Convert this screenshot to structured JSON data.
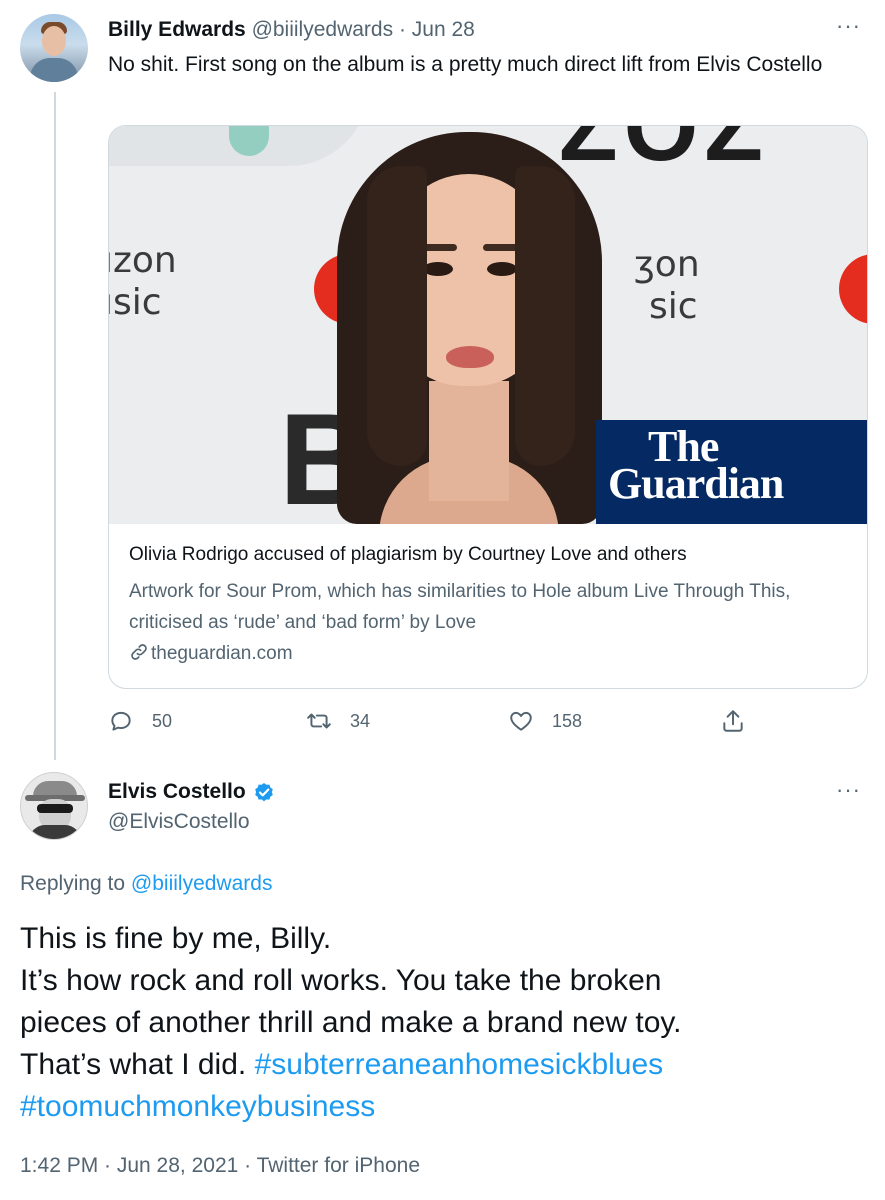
{
  "tweet1": {
    "name": "Billy Edwards",
    "handle": "@biiilyedwards",
    "sep": "·",
    "date": "Jun 28",
    "more": "···",
    "text": "No shit. First song on the album is a pretty much direct lift from Elvis Costello",
    "card": {
      "title": "Olivia Rodrigo accused of plagiarism by Courtney Love and others",
      "description": "Artwork for Sour Prom, which has similarities to Hole album Live Through This, criticised as ‘rude’ and ‘bad form’ by Love",
      "domain": "theguardian.com",
      "brand_the": "The",
      "brand_guardian": "Guardian",
      "backdrop": {
        "logo1_line1": "ızon",
        "logo1_line2": "ısic",
        "logo2_line1": "ʒon",
        "logo2_line2": "sic",
        "big_top": "ZOZ",
        "big_bottom": "B"
      }
    },
    "actions": {
      "replies": "50",
      "retweets": "34",
      "likes": "158"
    }
  },
  "tweet2": {
    "name": "Elvis Costello",
    "handle": "@ElvisCostello",
    "more": "···",
    "replying_prefix": "Replying to",
    "replying_to": "@biiilyedwards",
    "text_lines": [
      "This is fine by me, Billy.",
      "It’s how rock and roll works. You take the broken",
      "pieces of another thrill and make a brand new toy."
    ],
    "line4_text": "That’s what I did.",
    "hashtag1": "#subterreaneanhomesickblues",
    "hashtag2": "#toomuchmonkeybusiness",
    "meta": "1:42 PM · Jun 28, 2021 · Twitter for iPhone"
  },
  "colors": {
    "link_blue": "#1d9bf0",
    "muted": "#536471",
    "guardian_blue": "#052962",
    "verified_blue": "#1d9bf0"
  },
  "icons": {
    "reply": "reply-icon",
    "retweet": "retweet-icon",
    "like": "heart-icon",
    "share": "share-icon",
    "verified": "verified-badge-icon",
    "link": "link-icon",
    "more": "more-icon"
  }
}
